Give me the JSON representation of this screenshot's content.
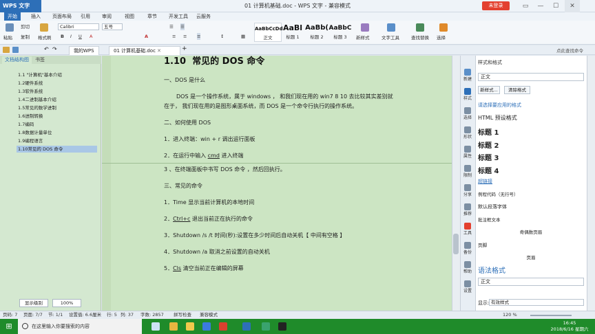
{
  "titlebar": {
    "app_name": "WPS 文字",
    "doc_title": "01 计算机基础.doc - WPS 文字 - 兼容模式",
    "login_label": "未登录"
  },
  "menu": [
    "开始",
    "插入",
    "页面布局",
    "引用",
    "审阅",
    "视图",
    "章节",
    "开发工具",
    "云服务"
  ],
  "ribbon": {
    "paste": "粘贴",
    "cut": "剪切",
    "copy": "复制",
    "format_painter": "格式刷",
    "font": "Calibri",
    "size": "五号",
    "styles": [
      {
        "sample": "AaBbCcDd",
        "label": "正文"
      },
      {
        "sample": "AaBl",
        "label": "标题 1"
      },
      {
        "sample": "AaBb(",
        "label": "标题 2"
      },
      {
        "sample": "AaBbC",
        "label": "标题 3"
      }
    ],
    "new_style": "新样式",
    "text_tools": "文字工具",
    "find_replace": "查找替换",
    "select": "选择"
  },
  "tabs": {
    "home": "我的WPS",
    "doc": "01 计算机基础.doc",
    "search_placeholder": "点此查找命令"
  },
  "nav": {
    "tab_outline": "文档结构图",
    "tab_bookmark": "书签",
    "items": [
      "1.1 \"计算机\"基本介绍",
      "1.2硬件系统",
      "1.3软件系统",
      "1.4二进制基本介绍",
      "1.5常见的数学进制",
      "1.6进制转换",
      "1.7编码",
      "1.8数据计量单位",
      "1.9编程语言",
      "1.10常见的 DOS 命令"
    ]
  },
  "document": {
    "heading_num": "1.10",
    "heading_text": "常见的 DOS 命令",
    "s1": "一、DOS 是什么",
    "p1a": "DOS 是一个操作系统，属于 windows ， 和我们现在用的 win7 8 10 去比较其实差别就",
    "p1b": "在于， 我们现在用的是图形桌面系统，而 DOS 是一个命令行执行的操作系统。",
    "s2": "二、如何使用 DOS",
    "step1": "1．进入终端：win + r 调出运行面板",
    "step2_pre": "2．在运行中输入 ",
    "step2_cmd": "cmd",
    "step2_post": " 进入终端",
    "step3": "3 、在终端面板中书写 DOS 命令 ，然后回执行。",
    "s3": "三、常见的命令",
    "c1": "1．Time 显示当前计算机的本地时间",
    "c2_pre": "2．",
    "c2_cmd": "Ctrl+c",
    "c2_post": " 退出当前正在执行的命令",
    "c3": "3．Shutdown /s /t 时间(秒):设置在多少时间后自动关机【 中间有空格 】",
    "c4": "4．Shutdown /a 取消之前设置的自动关机",
    "c5_pre": "5．",
    "c5_cmd": "Cls",
    "c5_post": " 清空当前正在编辑的屏幕"
  },
  "sidebar": [
    "新建",
    "样式",
    "选择",
    "形状",
    "属性",
    "限制",
    "分享",
    "推荐",
    "工具",
    "备份",
    "帮助",
    "设置"
  ],
  "styles_panel": {
    "title": "样式和格式",
    "current": "正文",
    "new_style": "新样式...",
    "clear_format": "清除格式",
    "apply_label": "请选择要应用的格式",
    "items": [
      "HTML 预设格式",
      "标题 1",
      "标题 2",
      "标题 3",
      "标题 4",
      "超链接",
      "例程代码（无行号）",
      "默认段落字体",
      "批注框文本",
      "奇偶数页眉",
      "页脚",
      "页眉"
    ],
    "section_title": "语法格式",
    "section_value": "正文",
    "show_label": "显示:",
    "show_value": "有效样式"
  },
  "bottom": {
    "show_level": "显示级别",
    "zoom": "100%"
  },
  "status": {
    "page": "页码: 7",
    "pages": "页面: 7/7",
    "section": "节: 1/1",
    "setting": "设置值: 6.6厘米",
    "row": "行: 5",
    "col": "列: 37",
    "words": "字数: 2857",
    "spell": "拼写检查",
    "compat": "兼容模式",
    "zoom_pct": "120 %"
  },
  "taskbar": {
    "search_placeholder": "在这里输入你要搜索的内容",
    "time": "16:45",
    "date": "2018/6/16 星期六"
  },
  "colors": {
    "accent": "#2d6fb8",
    "document_bg": "#cce5c3",
    "taskbar": "#1f8b2a",
    "login": "#e3402f"
  }
}
